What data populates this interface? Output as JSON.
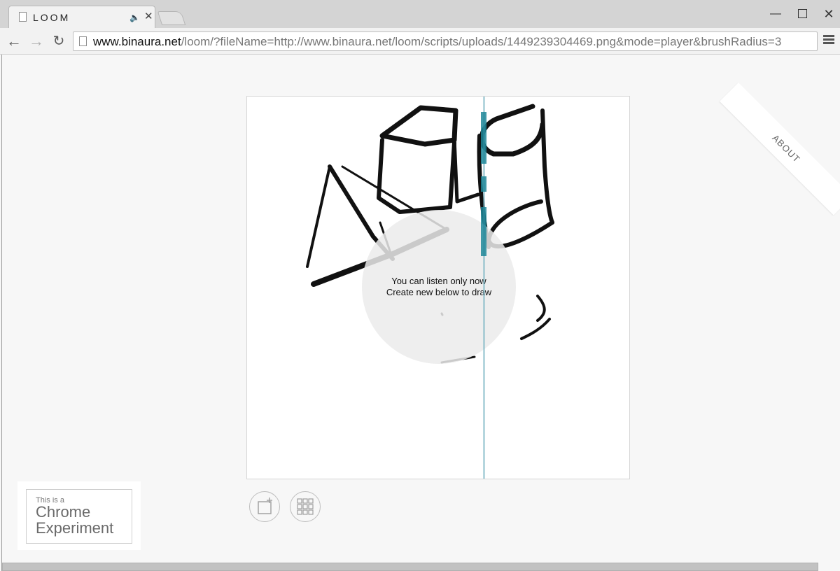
{
  "browser": {
    "tab_title": "LOOM",
    "tab_audio_icon": "speaker-icon",
    "tab_close_icon": "close-icon",
    "window_minimize": "minimize-icon",
    "window_maximize": "maximize-icon",
    "window_close": "close-icon",
    "url_host": "www.binaura.net",
    "url_rest": "/loom/?fileName=http://www.binaura.net/loom/scripts/uploads/1449239304469.png&mode=player&brushRadius=3",
    "back_icon": "arrow-left-icon",
    "forward_icon": "arrow-right-icon",
    "reload_icon": "reload-icon",
    "menu_icon": "hamburger-menu-icon"
  },
  "page": {
    "about_label": "ABOUT",
    "overlay": {
      "line1": "You can listen only now",
      "line2": "Create new below to draw"
    },
    "new_drawing_icon": "new-canvas-icon",
    "gallery_icon": "grid-icon",
    "chrome_experiment": {
      "small": "This is a",
      "line1": "Chrome",
      "line2": "Experiment"
    },
    "colors": {
      "stroke": "#111111",
      "playhead": "#78b4c3",
      "playhead_hit": "#1a7f93",
      "background": "#f7f7f7"
    }
  }
}
